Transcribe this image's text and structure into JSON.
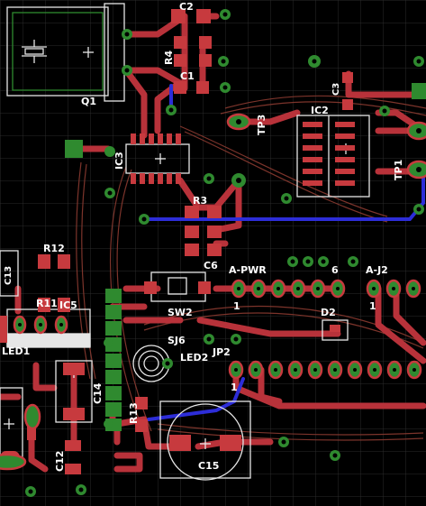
{
  "board": {
    "background": "#000000",
    "grid_color": "#2a2a2a",
    "trace_color": "#b8323a",
    "via_color": "#2f8a2f",
    "pad_color": "#c73a3e",
    "silk_color": "#e6e6e6",
    "bottom_trace_color": "#2d2dd8",
    "hatch_color": "#8a3a30"
  },
  "labels": {
    "q1": "Q1",
    "c2": "C2",
    "r4": "R4",
    "c1": "C1",
    "c3": "C3",
    "ic2": "IC2",
    "tp3": "TP3",
    "tp1": "TP1",
    "ic3": "IC3",
    "r3": "R3",
    "c6": "C6",
    "r12": "R12",
    "c13": "C13",
    "r11": "R11",
    "ic5": "IC5",
    "led1": "LED1",
    "a_pwr": "A-PWR",
    "a_pwr_pin1": "1",
    "a_pwr_pin6": "6",
    "a_j2": "A-J2",
    "a_j2_pin1": "1",
    "d2": "D2",
    "sw2": "SW2",
    "sj6": "SJ6",
    "led2": "LED2",
    "jp2": "JP2",
    "jp2_pin1": "1",
    "c14": "C14",
    "r13": "R13",
    "c15": "C15",
    "c12": "C12"
  }
}
